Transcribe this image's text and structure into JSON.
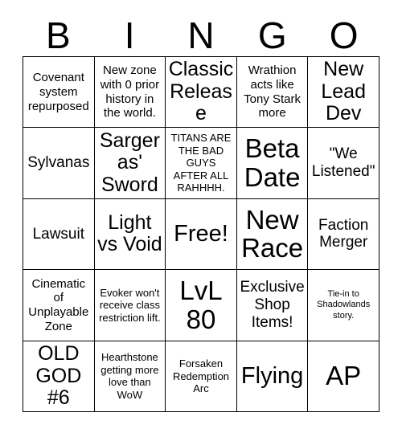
{
  "header": {
    "letters": [
      "B",
      "I",
      "N",
      "G",
      "O"
    ]
  },
  "grid": {
    "rows": 5,
    "columns": 5,
    "cells": [
      {
        "text": "Covenant system repurposed",
        "size": "sm"
      },
      {
        "text": "New zone with 0 prior history in the world.",
        "size": "sm"
      },
      {
        "text": "Classic Release",
        "size": "lg"
      },
      {
        "text": "Wrathion acts like Tony Stark more",
        "size": "sm"
      },
      {
        "text": "New Lead Dev",
        "size": "lg"
      },
      {
        "text": "Sylvanas",
        "size": "md"
      },
      {
        "text": "Sargeras' Sword",
        "size": "lg"
      },
      {
        "text": "TITANS ARE THE BAD GUYS AFTER ALL RAHHHH.",
        "size": "xs"
      },
      {
        "text": "Beta Date",
        "size": "xxl"
      },
      {
        "text": "\"We Listened\"",
        "size": "md"
      },
      {
        "text": "Lawsuit",
        "size": "md"
      },
      {
        "text": "Light vs Void",
        "size": "lg"
      },
      {
        "text": "Free!",
        "size": "xl"
      },
      {
        "text": "New Race",
        "size": "xxl"
      },
      {
        "text": "Faction Merger",
        "size": "md"
      },
      {
        "text": "Cinematic of Unplayable Zone",
        "size": "sm"
      },
      {
        "text": "Evoker won't receive class restriction lift.",
        "size": "xs"
      },
      {
        "text": "LvL 80",
        "size": "xxl"
      },
      {
        "text": "Exclusive Shop Items!",
        "size": "md"
      },
      {
        "text": "Tie-in to Shadowlands story.",
        "size": "xxs"
      },
      {
        "text": "OLD GOD #6",
        "size": "lg"
      },
      {
        "text": "Hearthstone getting more love than WoW",
        "size": "xs"
      },
      {
        "text": "Forsaken Redemption Arc",
        "size": "xs"
      },
      {
        "text": "Flying",
        "size": "xl"
      },
      {
        "text": "AP",
        "size": "xxl"
      }
    ]
  }
}
